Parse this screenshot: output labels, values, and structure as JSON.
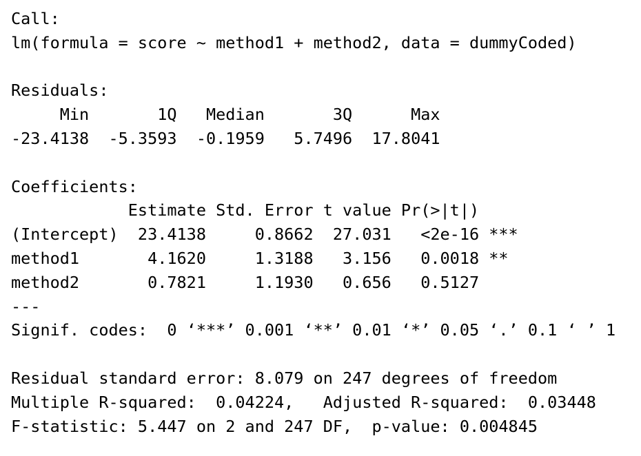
{
  "call": {
    "label": "Call:",
    "formula": "lm(formula = score ~ method1 + method2, data = dummyCoded)"
  },
  "residuals": {
    "label": "Residuals:",
    "header": "     Min       1Q   Median       3Q      Max ",
    "values": "-23.4138  -5.3593  -0.1959   5.7496  17.8041 "
  },
  "coefficients": {
    "label": "Coefficients:",
    "header": "            Estimate Std. Error t value Pr(>|t|)    ",
    "rows": [
      "(Intercept)  23.4138     0.8662  27.031   <2e-16 ***",
      "method1       4.1620     1.3188   3.156   0.0018 ** ",
      "method2       0.7821     1.1930   0.656   0.5127    "
    ],
    "separator": "---",
    "signif_codes": "Signif. codes:  0 ‘***’ 0.001 ‘**’ 0.01 ‘*’ 0.05 ‘.’ 0.1 ‘ ’ 1"
  },
  "summary": {
    "residual_se": "Residual standard error: 8.079 on 247 degrees of freedom",
    "r_squared": "Multiple R-squared:  0.04224,\tAdjusted R-squared:  0.03448 ",
    "f_statistic": "F-statistic: 5.447 on 2 and 247 DF,  p-value: 0.004845"
  }
}
